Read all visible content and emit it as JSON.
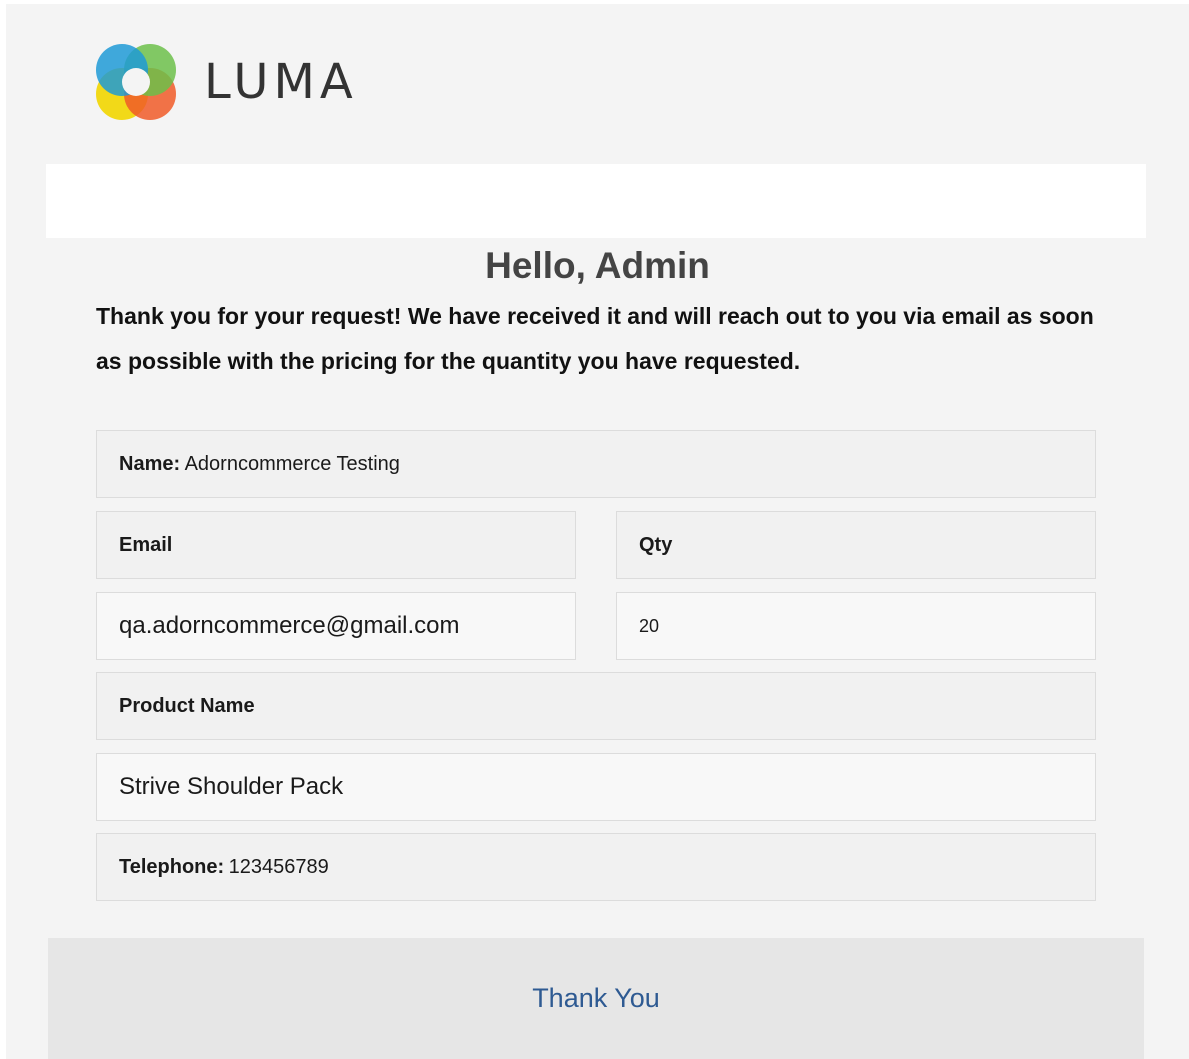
{
  "brand": {
    "logo_icon": "luma-logo-icon",
    "name": "LUMA"
  },
  "greeting": "Hello, Admin",
  "message": "Thank you for your request! We have received it and will reach out to you via email as soon as possible with the pricing for the quantity you have requested.",
  "details": {
    "name_label": "Name:",
    "name_value": "Adorncommerce Testing",
    "email_label": "Email",
    "email_value": "qa.adorncommerce@gmail.com",
    "qty_label": "Qty",
    "qty_value": "20",
    "product_label": "Product Name",
    "product_value": "Strive Shoulder Pack",
    "telephone_label": "Telephone:",
    "telephone_value": "123456789"
  },
  "footer": {
    "text": "Thank You"
  },
  "colors": {
    "background": "#f4f4f4",
    "footer_bg": "#e6e6e6",
    "footer_text": "#2e5a92",
    "heading": "#444444"
  }
}
